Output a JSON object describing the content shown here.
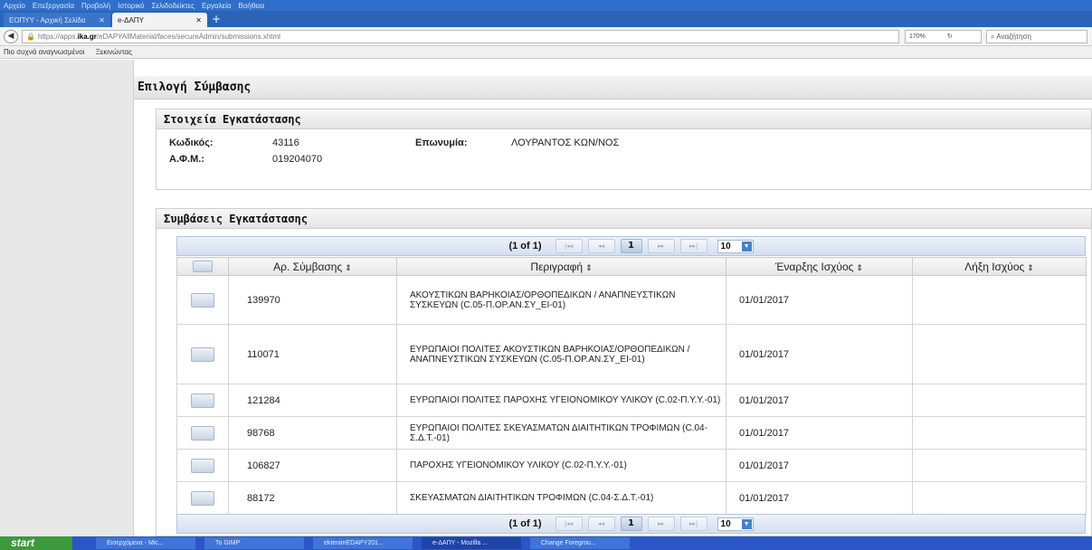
{
  "browser": {
    "menu": [
      "Αρχείο",
      "Επεξεργασία",
      "Προβολή",
      "Ιστορικό",
      "Σελιδοδείκτες",
      "Εργαλεία",
      "Βοήθεια"
    ],
    "tabs": [
      {
        "label": "ΕΟΠΥΥ - Αρχική Σελίδα",
        "active": false
      },
      {
        "label": "e-ΔΑΠΥ",
        "active": true
      }
    ],
    "new_tab": "+",
    "url_prefix": "https://apps.",
    "url_host": "ika.gr",
    "url_path": "/eDAPYAllMaterial/faces/secureAdmin/submissions.xhtml",
    "zoom": "170%",
    "search_placeholder": "Αναζήτηση",
    "bookmarks": [
      "Πιο συχνά αναγνωσμένοι",
      "Ξεκινώντας"
    ]
  },
  "page": {
    "title": "Επιλογή Σύμβασης",
    "installation_panel": {
      "header": "Στοιχεία Εγκατάστασης",
      "code_label": "Κωδικός:",
      "code_value": "43116",
      "name_label": "Επωνυμία:",
      "name_value": "ΛΟΥΡΑΝΤΟΣ ΚΩΝ/ΝΟΣ",
      "afm_label": "Α.Φ.Μ.:",
      "afm_value": "019204070"
    },
    "contracts_panel": {
      "header": "Συμβάσεις Εγκατάστασης",
      "paginator": {
        "text": "(1 of 1)",
        "first": "|◂◂",
        "prev": "◂◂",
        "current_page": "1",
        "next": "▸▸",
        "last": "▸▸|",
        "rows_per_page": "10"
      },
      "columns": [
        "",
        "Αρ. Σύμβασης",
        "Περιγραφή",
        "Έναρξης Ισχύος",
        "Λήξη Ισχύος"
      ],
      "rows": [
        {
          "number": "139970",
          "description": "ΑΚΟΥΣΤΙΚΩΝ ΒΑΡΗΚΟΙΑΣ/ΟΡΘΟΠΕΔΙΚΩΝ / ΑΝΑΠΝΕΥΣΤΙΚΩΝ ΣΥΣΚΕΥΩΝ (C.05-Π.ΟΡ.ΑΝ.ΣΥ_ΕΙ-01)",
          "start": "01/01/2017",
          "end": ""
        },
        {
          "number": "110071",
          "description": "ΕΥΡΩΠΑΙΟΙ ΠΟΛΙΤΕΣ ΑΚΟΥΣΤΙΚΩΝ ΒΑΡΗΚΟΙΑΣ/ΟΡΘΟΠΕΔΙΚΩΝ / ΑΝΑΠΝΕΥΣΤΙΚΩΝ ΣΥΣΚΕΥΩΝ (C.05-Π.ΟΡ.ΑΝ.ΣΥ_ΕΙ-01)",
          "start": "01/01/2017",
          "end": ""
        },
        {
          "number": "121284",
          "description": "ΕΥΡΩΠΑΙΟΙ ΠΟΛΙΤΕΣ ΠΑΡΟΧΗΣ ΥΓΕΙΟΝΟΜΙΚΟΥ ΥΛΙΚΟΥ (C.02-Π.Υ.Υ.-01)",
          "start": "01/01/2017",
          "end": ""
        },
        {
          "number": "98768",
          "description": "ΕΥΡΩΠΑΙΟΙ ΠΟΛΙΤΕΣ ΣΚΕΥΑΣΜΑΤΩΝ ΔΙΑΙΤΗΤΙΚΩΝ ΤΡΟΦΙΜΩΝ (C.04-Σ.Δ.Τ.-01)",
          "start": "01/01/2017",
          "end": ""
        },
        {
          "number": "106827",
          "description": "ΠΑΡΟΧΗΣ ΥΓΕΙΟΝΟΜΙΚΟΥ ΥΛΙΚΟΥ (C.02-Π.Υ.Υ.-01)",
          "start": "01/01/2017",
          "end": ""
        },
        {
          "number": "88172",
          "description": "ΣΚΕΥΑΣΜΑΤΩΝ ΔΙΑΙΤΗΤΙΚΩΝ ΤΡΟΦΙΜΩΝ (C.04-Σ.Δ.Τ.-01)",
          "start": "01/01/2017",
          "end": ""
        }
      ]
    }
  },
  "taskbar": {
    "start": "start",
    "tasks": [
      "Εισερχόμενα - Mic...",
      "To GIMP",
      "ektenimEDAPY201...",
      "e-ΔΑΠΥ - Mozilla ...",
      "Change Foregrou..."
    ]
  },
  "colors": {
    "accent": "#2f6fc9",
    "taskbar": "#2a56c6",
    "start_button": "#3c9a3c",
    "pager_bg": "#d4dfee"
  }
}
